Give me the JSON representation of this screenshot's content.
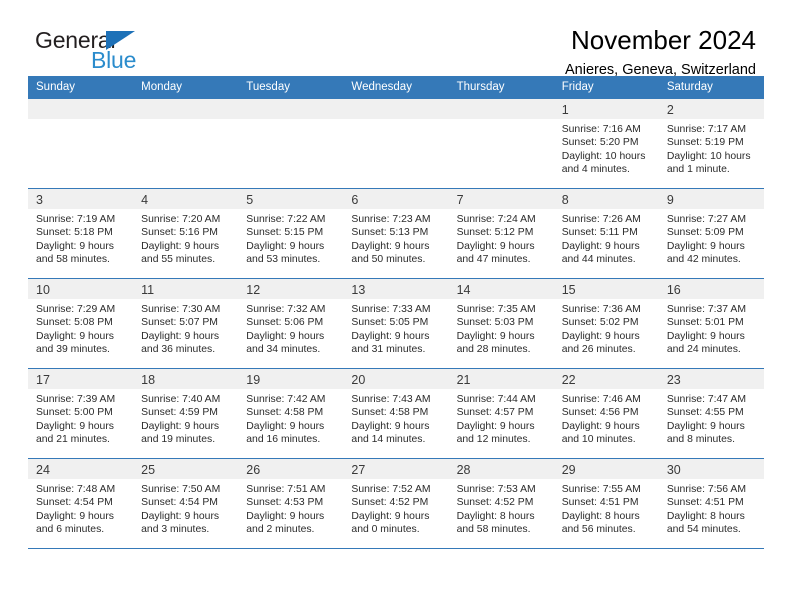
{
  "brand": {
    "name_part1": "General",
    "name_part2": "Blue",
    "accent_color": "#2b8ccc",
    "triangle_color": "#1d71b8"
  },
  "header": {
    "title": "November 2024",
    "subtitle": "Anieres, Geneva, Switzerland"
  },
  "calendar": {
    "header_bg": "#3579b8",
    "daynum_bg": "#f0f0f0",
    "weekday_headers": [
      "Sunday",
      "Monday",
      "Tuesday",
      "Wednesday",
      "Thursday",
      "Friday",
      "Saturday"
    ],
    "weeks": [
      [
        {
          "day": "",
          "lines": []
        },
        {
          "day": "",
          "lines": []
        },
        {
          "day": "",
          "lines": []
        },
        {
          "day": "",
          "lines": []
        },
        {
          "day": "",
          "lines": []
        },
        {
          "day": "1",
          "lines": [
            "Sunrise: 7:16 AM",
            "Sunset: 5:20 PM",
            "Daylight: 10 hours",
            "and 4 minutes."
          ]
        },
        {
          "day": "2",
          "lines": [
            "Sunrise: 7:17 AM",
            "Sunset: 5:19 PM",
            "Daylight: 10 hours",
            "and 1 minute."
          ]
        }
      ],
      [
        {
          "day": "3",
          "lines": [
            "Sunrise: 7:19 AM",
            "Sunset: 5:18 PM",
            "Daylight: 9 hours",
            "and 58 minutes."
          ]
        },
        {
          "day": "4",
          "lines": [
            "Sunrise: 7:20 AM",
            "Sunset: 5:16 PM",
            "Daylight: 9 hours",
            "and 55 minutes."
          ]
        },
        {
          "day": "5",
          "lines": [
            "Sunrise: 7:22 AM",
            "Sunset: 5:15 PM",
            "Daylight: 9 hours",
            "and 53 minutes."
          ]
        },
        {
          "day": "6",
          "lines": [
            "Sunrise: 7:23 AM",
            "Sunset: 5:13 PM",
            "Daylight: 9 hours",
            "and 50 minutes."
          ]
        },
        {
          "day": "7",
          "lines": [
            "Sunrise: 7:24 AM",
            "Sunset: 5:12 PM",
            "Daylight: 9 hours",
            "and 47 minutes."
          ]
        },
        {
          "day": "8",
          "lines": [
            "Sunrise: 7:26 AM",
            "Sunset: 5:11 PM",
            "Daylight: 9 hours",
            "and 44 minutes."
          ]
        },
        {
          "day": "9",
          "lines": [
            "Sunrise: 7:27 AM",
            "Sunset: 5:09 PM",
            "Daylight: 9 hours",
            "and 42 minutes."
          ]
        }
      ],
      [
        {
          "day": "10",
          "lines": [
            "Sunrise: 7:29 AM",
            "Sunset: 5:08 PM",
            "Daylight: 9 hours",
            "and 39 minutes."
          ]
        },
        {
          "day": "11",
          "lines": [
            "Sunrise: 7:30 AM",
            "Sunset: 5:07 PM",
            "Daylight: 9 hours",
            "and 36 minutes."
          ]
        },
        {
          "day": "12",
          "lines": [
            "Sunrise: 7:32 AM",
            "Sunset: 5:06 PM",
            "Daylight: 9 hours",
            "and 34 minutes."
          ]
        },
        {
          "day": "13",
          "lines": [
            "Sunrise: 7:33 AM",
            "Sunset: 5:05 PM",
            "Daylight: 9 hours",
            "and 31 minutes."
          ]
        },
        {
          "day": "14",
          "lines": [
            "Sunrise: 7:35 AM",
            "Sunset: 5:03 PM",
            "Daylight: 9 hours",
            "and 28 minutes."
          ]
        },
        {
          "day": "15",
          "lines": [
            "Sunrise: 7:36 AM",
            "Sunset: 5:02 PM",
            "Daylight: 9 hours",
            "and 26 minutes."
          ]
        },
        {
          "day": "16",
          "lines": [
            "Sunrise: 7:37 AM",
            "Sunset: 5:01 PM",
            "Daylight: 9 hours",
            "and 24 minutes."
          ]
        }
      ],
      [
        {
          "day": "17",
          "lines": [
            "Sunrise: 7:39 AM",
            "Sunset: 5:00 PM",
            "Daylight: 9 hours",
            "and 21 minutes."
          ]
        },
        {
          "day": "18",
          "lines": [
            "Sunrise: 7:40 AM",
            "Sunset: 4:59 PM",
            "Daylight: 9 hours",
            "and 19 minutes."
          ]
        },
        {
          "day": "19",
          "lines": [
            "Sunrise: 7:42 AM",
            "Sunset: 4:58 PM",
            "Daylight: 9 hours",
            "and 16 minutes."
          ]
        },
        {
          "day": "20",
          "lines": [
            "Sunrise: 7:43 AM",
            "Sunset: 4:58 PM",
            "Daylight: 9 hours",
            "and 14 minutes."
          ]
        },
        {
          "day": "21",
          "lines": [
            "Sunrise: 7:44 AM",
            "Sunset: 4:57 PM",
            "Daylight: 9 hours",
            "and 12 minutes."
          ]
        },
        {
          "day": "22",
          "lines": [
            "Sunrise: 7:46 AM",
            "Sunset: 4:56 PM",
            "Daylight: 9 hours",
            "and 10 minutes."
          ]
        },
        {
          "day": "23",
          "lines": [
            "Sunrise: 7:47 AM",
            "Sunset: 4:55 PM",
            "Daylight: 9 hours",
            "and 8 minutes."
          ]
        }
      ],
      [
        {
          "day": "24",
          "lines": [
            "Sunrise: 7:48 AM",
            "Sunset: 4:54 PM",
            "Daylight: 9 hours",
            "and 6 minutes."
          ]
        },
        {
          "day": "25",
          "lines": [
            "Sunrise: 7:50 AM",
            "Sunset: 4:54 PM",
            "Daylight: 9 hours",
            "and 3 minutes."
          ]
        },
        {
          "day": "26",
          "lines": [
            "Sunrise: 7:51 AM",
            "Sunset: 4:53 PM",
            "Daylight: 9 hours",
            "and 2 minutes."
          ]
        },
        {
          "day": "27",
          "lines": [
            "Sunrise: 7:52 AM",
            "Sunset: 4:52 PM",
            "Daylight: 9 hours",
            "and 0 minutes."
          ]
        },
        {
          "day": "28",
          "lines": [
            "Sunrise: 7:53 AM",
            "Sunset: 4:52 PM",
            "Daylight: 8 hours",
            "and 58 minutes."
          ]
        },
        {
          "day": "29",
          "lines": [
            "Sunrise: 7:55 AM",
            "Sunset: 4:51 PM",
            "Daylight: 8 hours",
            "and 56 minutes."
          ]
        },
        {
          "day": "30",
          "lines": [
            "Sunrise: 7:56 AM",
            "Sunset: 4:51 PM",
            "Daylight: 8 hours",
            "and 54 minutes."
          ]
        }
      ]
    ]
  }
}
